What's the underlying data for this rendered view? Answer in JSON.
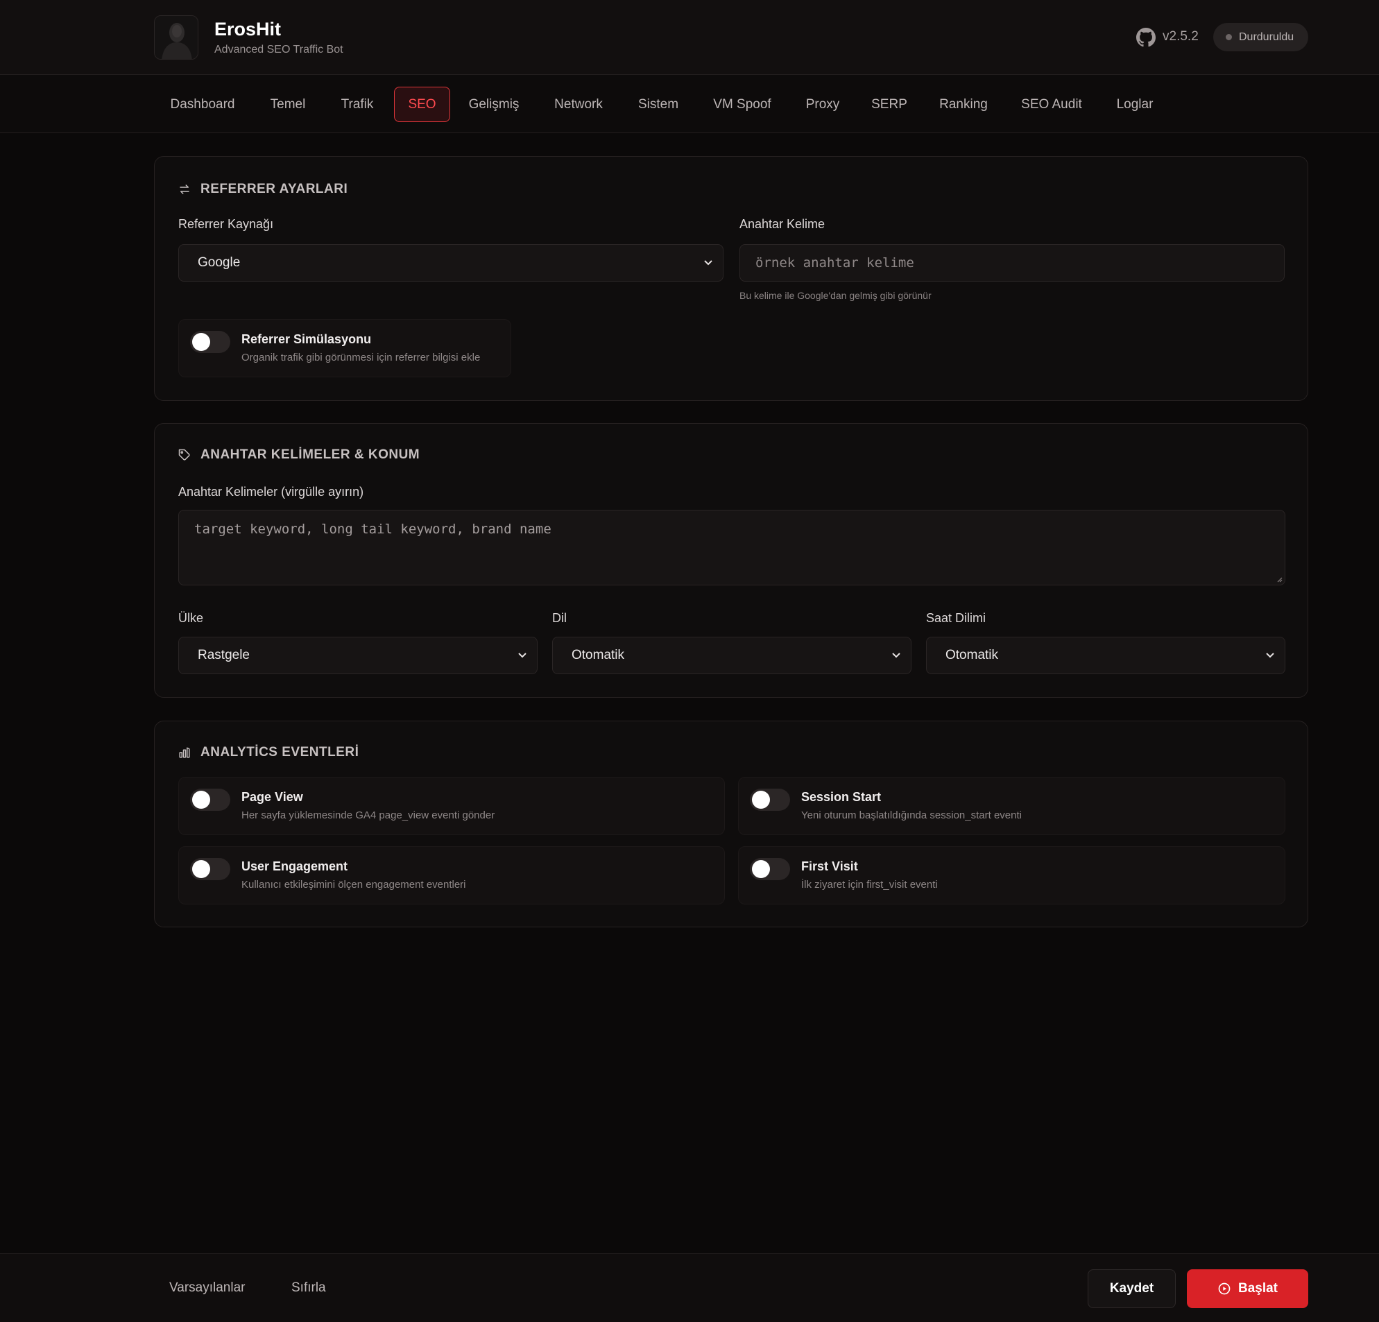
{
  "header": {
    "app_name": "ErosHit",
    "app_subtitle": "Advanced SEO Traffic Bot",
    "version": "v2.5.2",
    "status": "Durduruldu"
  },
  "nav": {
    "tabs": [
      {
        "label": "Dashboard"
      },
      {
        "label": "Temel"
      },
      {
        "label": "Trafik"
      },
      {
        "label": "SEO",
        "active": true
      },
      {
        "label": "Gelişmiş"
      },
      {
        "label": "Network"
      },
      {
        "label": "Sistem"
      },
      {
        "label": "VM Spoof"
      },
      {
        "label": "Proxy"
      },
      {
        "label": "SERP"
      },
      {
        "label": "Ranking"
      },
      {
        "label": "SEO Audit"
      },
      {
        "label": "Loglar"
      }
    ]
  },
  "referrer": {
    "title": "REFERRER AYARLARI",
    "source_label": "Referrer Kaynağı",
    "source_value": "Google",
    "keyword_label": "Anahtar Kelime",
    "keyword_placeholder": "örnek anahtar kelime",
    "keyword_hint": "Bu kelime ile Google'dan gelmiş gibi görünür",
    "sim_title": "Referrer Simülasyonu",
    "sim_desc": "Organik trafik gibi görünmesi için referrer bilgisi ekle"
  },
  "keywords": {
    "title": "ANAHTAR KELİMELER & KONUM",
    "keywords_label": "Anahtar Kelimeler (virgülle ayırın)",
    "keywords_placeholder": "target keyword, long tail keyword, brand name",
    "country_label": "Ülke",
    "country_value": "Rastgele",
    "language_label": "Dil",
    "language_value": "Otomatik",
    "timezone_label": "Saat Dilimi",
    "timezone_value": "Otomatik"
  },
  "analytics": {
    "title": "ANALYTİCS EVENTLERİ",
    "events": [
      {
        "title": "Page View",
        "desc": "Her sayfa yüklemesinde GA4 page_view eventi gönder"
      },
      {
        "title": "Session Start",
        "desc": "Yeni oturum başlatıldığında session_start eventi"
      },
      {
        "title": "User Engagement",
        "desc": "Kullanıcı etkileşimini ölçen engagement eventleri"
      },
      {
        "title": "First Visit",
        "desc": "İlk ziyaret için first_visit eventi"
      }
    ]
  },
  "footer": {
    "defaults_label": "Varsayılanlar",
    "reset_label": "Sıfırla",
    "save_label": "Kaydet",
    "start_label": "Başlat"
  },
  "colors": {
    "accent": "#d92227",
    "background": "#0b0909",
    "card": "#0f0d0d"
  },
  "icons": {
    "github": "github-icon",
    "status": "status-dot",
    "referrer": "swap-arrows-icon",
    "keywords": "tag-icon",
    "analytics": "bar-chart-icon",
    "select": "chevron-down-icon",
    "start": "play-circle-icon"
  }
}
